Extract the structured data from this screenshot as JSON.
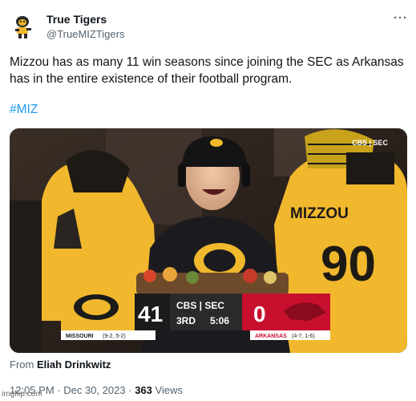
{
  "user": {
    "display_name": "True Tigers",
    "handle": "@TrueMIZTigers",
    "avatar_icon": "tiger-mascot-icon"
  },
  "more_icon": "more-options-icon",
  "tweet": {
    "text": "Mizzou has as many 11 win seasons since joining the SEC as Arkansas has in the entire existence of their football program.",
    "hashtag": "#MIZ"
  },
  "media": {
    "corner_network": "CBS | SEC",
    "jersey_text": "MIZZOU",
    "jersey_number": "90",
    "scorebug": {
      "home_team": "MISSOURI",
      "home_record": "(9-2, 5-2)",
      "home_score": "41",
      "network": "CBS | SEC",
      "period": "3RD",
      "clock": "5:06",
      "away_team": "ARKANSAS",
      "away_record": "(4-7, 1-6)",
      "away_score": "0"
    },
    "colors": {
      "mizzou_gold": "#f1b82d",
      "arkansas_red": "#c8102e",
      "scorebug_dark": "#1b1b1b"
    }
  },
  "source": {
    "label": "From",
    "name": "Eliah Drinkwitz"
  },
  "meta": {
    "time": "12:05 PM",
    "separator": "·",
    "date": "Dec 30, 2023",
    "views_count": "363",
    "views_label": "Views"
  },
  "watermark": "imgflip.com"
}
